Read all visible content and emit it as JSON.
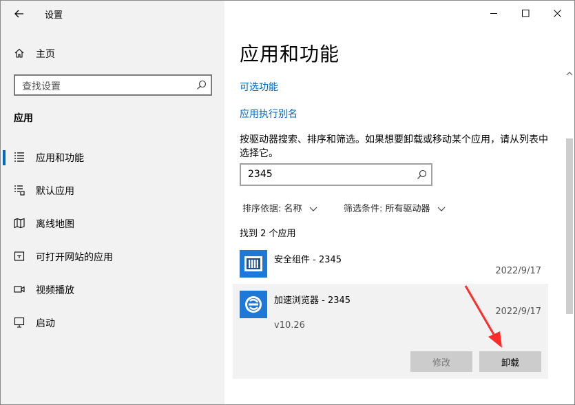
{
  "window": {
    "title": "设置"
  },
  "sidebar": {
    "home_label": "主页",
    "search_placeholder": "查找设置",
    "section_label": "应用",
    "items": [
      {
        "label": "应用和功能",
        "icon": "apps-features-icon",
        "selected": true
      },
      {
        "label": "默认应用",
        "icon": "default-apps-icon",
        "selected": false
      },
      {
        "label": "离线地图",
        "icon": "offline-maps-icon",
        "selected": false
      },
      {
        "label": "可打开网站的应用",
        "icon": "apps-for-websites-icon",
        "selected": false
      },
      {
        "label": "视频播放",
        "icon": "video-playback-icon",
        "selected": false
      },
      {
        "label": "启动",
        "icon": "startup-icon",
        "selected": false
      }
    ]
  },
  "main": {
    "title": "应用和功能",
    "links": [
      "可选功能",
      "应用执行别名"
    ],
    "description": "按驱动器搜索、排序和筛选。如果想要卸载或移动某个应用，请从列表中选择它。",
    "search_value": "2345",
    "sort_label": "排序依据:",
    "sort_value": "名称",
    "filter_label": "筛选条件:",
    "filter_value": "所有驱动器",
    "found_text": "找到 2 个应用",
    "apps": [
      {
        "name": "安全组件 - 2345",
        "date": "2022/9/17",
        "icon": "security-component-icon"
      },
      {
        "name": "加速浏览器 - 2345",
        "date": "2022/9/17",
        "version": "v10.26",
        "icon": "browser-icon",
        "selected": true
      }
    ],
    "modify_label": "修改",
    "uninstall_label": "卸载"
  },
  "colors": {
    "accent": "#0067c0",
    "sidebar_bg": "#f2f2f2",
    "app_icon_bg": "#1e78d6",
    "annotation_arrow": "#ff2a2a"
  }
}
